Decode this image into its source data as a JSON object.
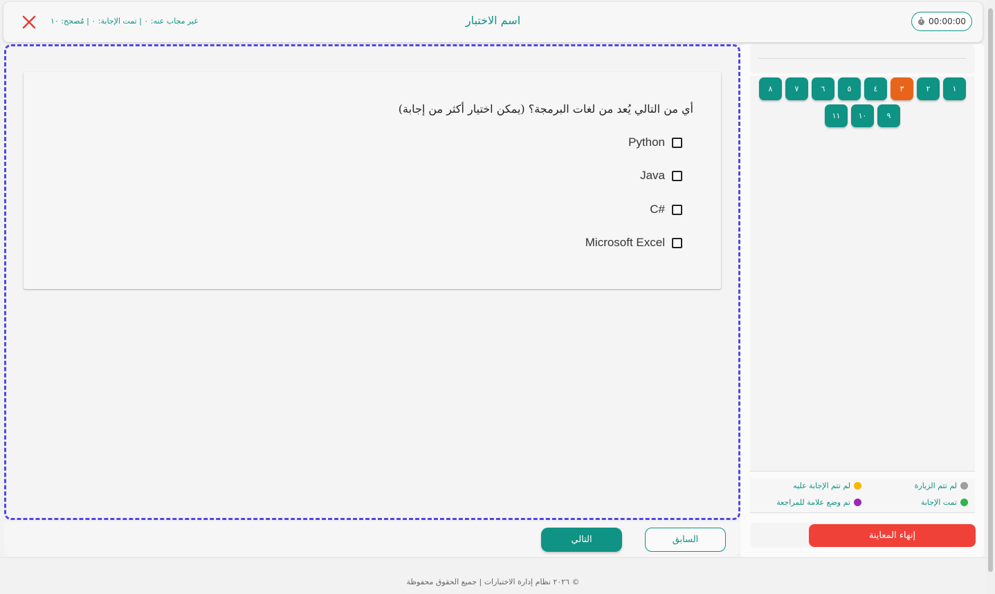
{
  "header": {
    "title": "اسم الاختبار",
    "stats": "غير مجاب عنه: ٠ | تمت الإجابة: ٠ | مُصحح: ١٠",
    "timer": "00:00:00"
  },
  "question": {
    "text": "أي من التالي يُعد من لغات البرمجة؟ (يمكن اختيار أكثر من إجابة)",
    "options": [
      "Python",
      "Java",
      "#C",
      "Microsoft Excel"
    ]
  },
  "navigation": {
    "next_label": "التالي",
    "prev_label": "السابق"
  },
  "sidebar": {
    "question_numbers": [
      "١",
      "٢",
      "٣",
      "٤",
      "٥",
      "٦",
      "٧",
      "٨",
      "٩",
      "١٠",
      "١١"
    ],
    "current_index": 2,
    "legend": {
      "not_visited": "لم تتم الزيارة",
      "not_answered": "لم تتم الإجابة عليه",
      "answered": "تمت الإجابة",
      "marked": "تم وضع علامة للمراجعة"
    },
    "end_label": "إنهاء المعاينة"
  },
  "footer": {
    "text": "© ٢٠٢٦ نظام إدارة الاختبارات | جميع الحقوق محفوظة"
  },
  "colors": {
    "accent": "#0f9384",
    "current": "#e8641b",
    "danger": "#ef4138",
    "not_visited": "#9e9e9e",
    "not_answered": "#f5b800",
    "answered": "#2fb34a",
    "marked": "#9c27b0"
  }
}
